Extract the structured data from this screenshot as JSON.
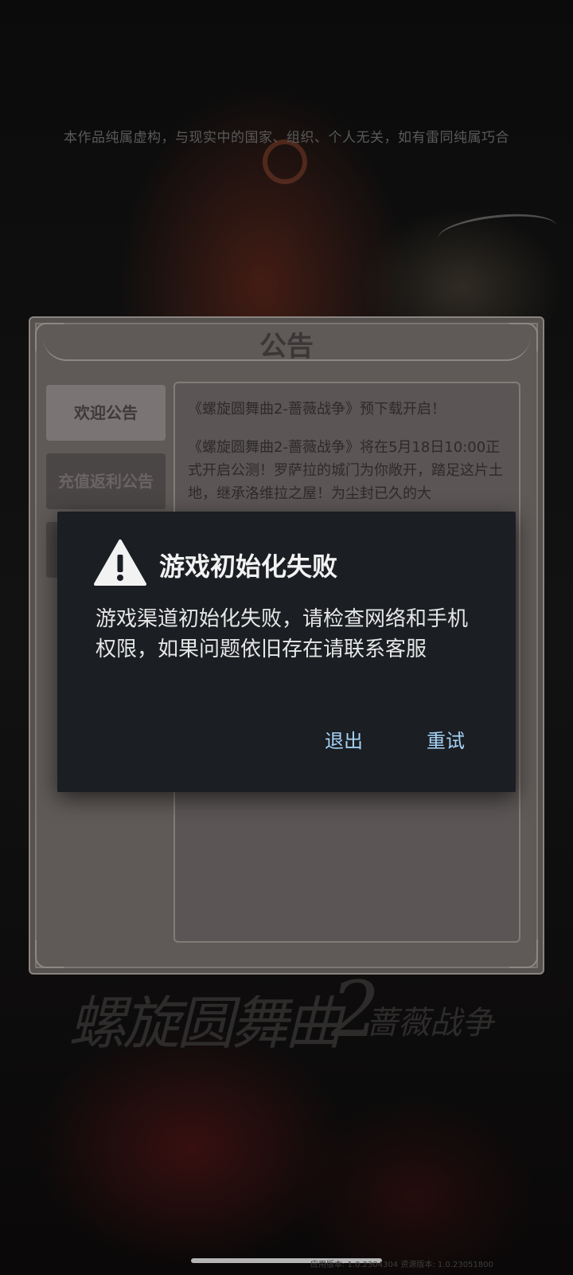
{
  "disclaimer": "本作品纯属虚构，与现实中的国家、组织、个人无关，如有雷同纯属巧合",
  "panel": {
    "title": "公告",
    "tabs": [
      {
        "label": "欢迎公告",
        "active": true
      },
      {
        "label": "充值返利公告",
        "active": false
      }
    ],
    "content": {
      "heading": "《螺旋圆舞曲2-蔷薇战争》预下载开启！",
      "paragraph": "《螺旋圆舞曲2-蔷薇战争》将在5月18日10:00正式开启公测！罗萨拉的城门为你敞开，踏足这片土地，继承洛维拉之屋！为尘封已久的大"
    }
  },
  "logo": {
    "main": "螺旋圆舞曲",
    "number": "2",
    "sub": "蔷薇战争"
  },
  "dialog": {
    "icon": "warning-icon",
    "title": "游戏初始化失败",
    "message": "游戏渠道初始化失败，请检查网络和手机权限，如果问题依旧存在请联系客服",
    "buttons": {
      "exit": "退出",
      "retry": "重试"
    },
    "button_color": "#a6d4f7"
  },
  "version": "应用版本: 1.0.2304304 资源版本: 1.0.23051800"
}
